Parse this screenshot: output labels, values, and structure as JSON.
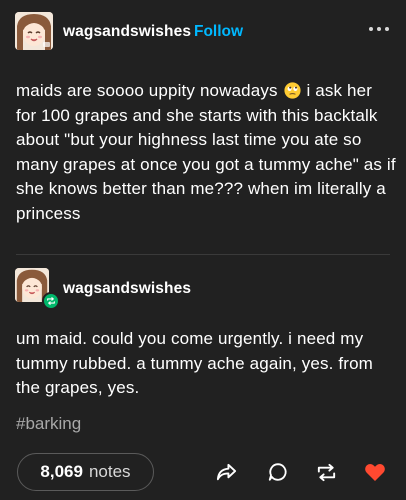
{
  "post": {
    "author": "wagsandswishes",
    "follow_label": "Follow",
    "text_before_emoji": "maids are soooo uppity nowadays",
    "text_after_emoji": " i ask her for 100 grapes and she starts with this backtalk about \"but your highness last time you ate so many grapes at once you got a tummy ache\" as if she knows better than me??? when im literally a princess",
    "emoji": "rolling-eyes-emoji"
  },
  "reblog": {
    "author": "wagsandswishes",
    "text": "um maid. could you come urgently. i need my tummy rubbed. a tummy ache again, yes. from the grapes, yes."
  },
  "tags": [
    "#barking"
  ],
  "footer": {
    "notes_count": "8,069",
    "notes_label": "notes",
    "actions": [
      "share-icon",
      "reply-icon",
      "reblog-icon",
      "like-icon"
    ]
  },
  "colors": {
    "background": "#212121",
    "accent": "#00b8ff",
    "like": "#ff4930",
    "reblog_badge": "#00b86b"
  }
}
